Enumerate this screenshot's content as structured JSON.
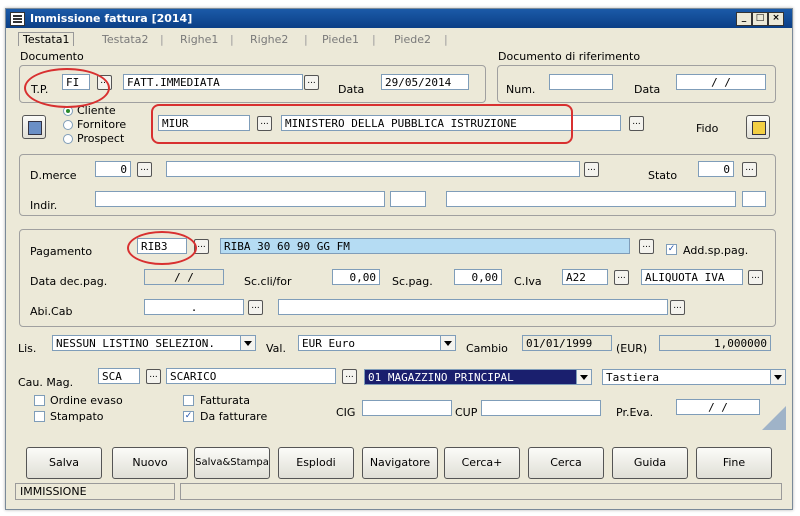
{
  "window": {
    "title": "Immissione fattura [2014]"
  },
  "tabs": [
    "Testata1",
    "Testata2",
    "Righe1",
    "Righe2",
    "Piede1",
    "Piede2"
  ],
  "documento": {
    "group_label": "Documento",
    "tp_label": "T.P.",
    "tp_value": "FI",
    "tp_desc": "FATT.IMMEDIATA",
    "data_label": "Data",
    "data_value": "29/05/2014"
  },
  "riferimento": {
    "group_label": "Documento di riferimento",
    "num_label": "Num.",
    "num_value": "",
    "data_label": "Data",
    "data_value": "/   /"
  },
  "soggetto": {
    "options": [
      "Cliente",
      "Fornitore",
      "Prospect"
    ],
    "selected": "Cliente",
    "code": "MIUR",
    "name": "MINISTERO DELLA PUBBLICA ISTRUZIONE",
    "fido_label": "Fido"
  },
  "destinazione": {
    "dmerce_label": "D.merce",
    "dmerce_value": "0",
    "stato_label": "Stato",
    "stato_value": "0",
    "indir_label": "Indir."
  },
  "pagamento": {
    "label": "Pagamento",
    "code": "RIB3",
    "desc": "RIBA 30 60 90 GG FM",
    "add_sp_label": "Add.sp.pag.",
    "add_sp_checked": true,
    "data_dec_label": "Data dec.pag.",
    "data_dec_value": "/   /",
    "sc_cli_label": "Sc.cli/for",
    "sc_cli_value": "0,00",
    "sc_pag_label": "Sc.pag.",
    "sc_pag_value": "0,00",
    "civa_label": "C.Iva",
    "civa_code": "A22",
    "civa_desc": "ALIQUOTA IVA",
    "abicab_label": "Abi.Cab",
    "abicab_value": "."
  },
  "listino": {
    "lis_label": "Lis.",
    "lis_value": "NESSUN LISTINO SELEZION.",
    "val_label": "Val.",
    "val_value": "EUR  Euro",
    "cambio_label": "Cambio",
    "cambio_date": "01/01/1999",
    "cambio_currency": "(EUR)",
    "cambio_value": "1,000000"
  },
  "magazzino": {
    "cau_label": "Cau. Mag.",
    "cau_code": "SCA",
    "cau_desc": "SCARICO",
    "mag_value": "01   MAGAZZINO PRINCIPAL",
    "input_value": "Tastiera"
  },
  "flags": {
    "ordine_evaso": "Ordine evaso",
    "stampato": "Stampato",
    "fatturata": "Fatturata",
    "da_fatturare": "Da fatturare",
    "cig_label": "CIG",
    "cup_label": "CUP",
    "preva_label": "Pr.Eva.",
    "preva_value": "/   /"
  },
  "buttons": [
    "Salva",
    "Nuovo",
    "Salva&Stampa",
    "Esplodi",
    "Navigatore",
    "Cerca+",
    "Cerca",
    "Guida",
    "Fine"
  ],
  "status": {
    "mode": "IMMISSIONE"
  },
  "colors": {
    "annotation": "#d83030",
    "title_bar": "#0b3f86",
    "highlight_field": "#b5dcf3"
  }
}
